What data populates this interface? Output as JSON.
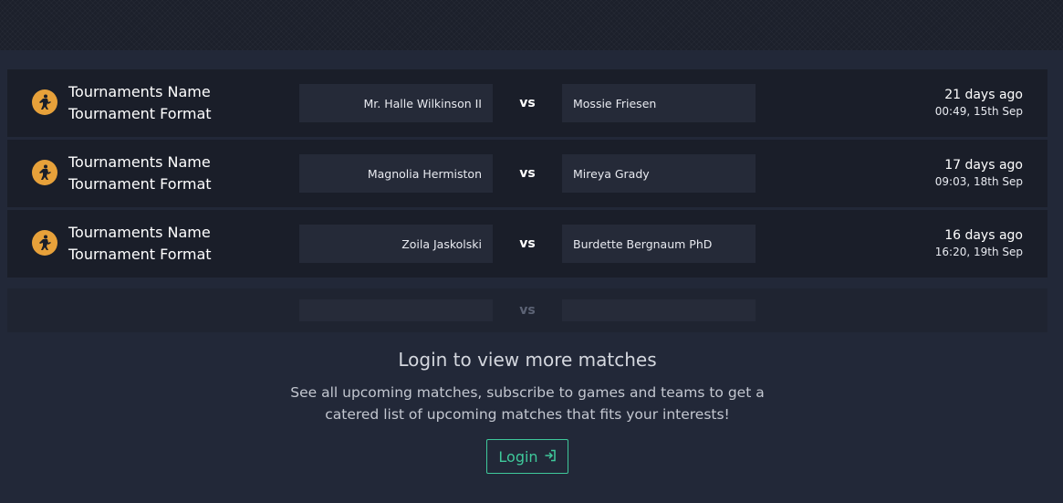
{
  "matches": [
    {
      "game_icon": "counter-strike-icon",
      "tournament_name": "Tournaments Name",
      "tournament_format": "Tournament Format",
      "team_left": "Mr. Halle Wilkinson II",
      "vs": "vs",
      "team_right": "Mossie Friesen",
      "time_ago": "21 days ago",
      "date": "00:49, 15th Sep"
    },
    {
      "game_icon": "counter-strike-icon",
      "tournament_name": "Tournaments Name",
      "tournament_format": "Tournament Format",
      "team_left": "Magnolia Hermiston",
      "vs": "vs",
      "team_right": "Mireya Grady",
      "time_ago": "17 days ago",
      "date": "09:03, 18th Sep"
    },
    {
      "game_icon": "counter-strike-icon",
      "tournament_name": "Tournaments Name",
      "tournament_format": "Tournament Format",
      "team_left": "Zoila Jaskolski",
      "vs": "vs",
      "team_right": "Burdette Bergnaum PhD",
      "time_ago": "16 days ago",
      "date": "16:20, 19th Sep"
    }
  ],
  "placeholder_row": {
    "vs": "vs"
  },
  "login_prompt": {
    "title": "Login to view more matches",
    "description": "See all upcoming matches, subscribe to games and teams to get a catered list of upcoming matches that fits your interests!",
    "button_label": "Login",
    "button_icon": "login-arrow-icon"
  },
  "colors": {
    "page_background": "#222838",
    "row_background": "#1a1e29",
    "team_box": "#252a38",
    "game_icon": "#e7a13a",
    "accent": "#3fc99b"
  }
}
